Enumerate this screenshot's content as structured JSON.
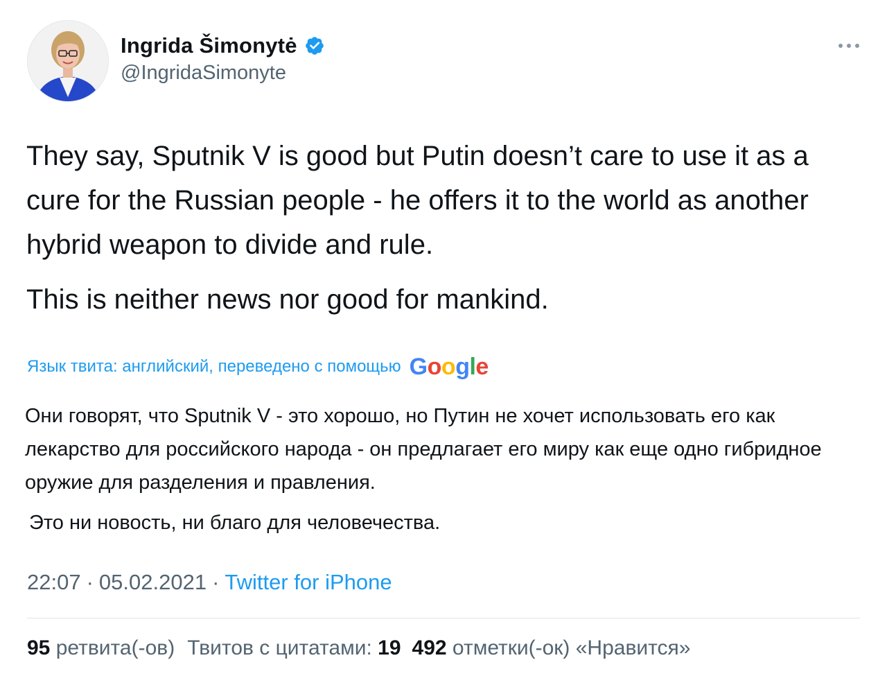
{
  "author": {
    "name": "Ingrida Šimonytė",
    "handle": "@IngridaSimonyte",
    "verified": true,
    "verified_color": "#1d9bf0"
  },
  "tweet": {
    "paragraphs": [
      "They say, Sputnik V is good but Putin doesn’t care to use it as a cure for the Russian people - he offers it to the world as another hybrid weapon to divide and rule.",
      "This is neither news nor good for mankind."
    ]
  },
  "translation": {
    "label": "Язык твита: английский, переведено с помощью",
    "provider_letters": [
      {
        "ch": "G",
        "color": "#4285f4"
      },
      {
        "ch": "o",
        "color": "#ea4335"
      },
      {
        "ch": "o",
        "color": "#fbbc05"
      },
      {
        "ch": "g",
        "color": "#4285f4"
      },
      {
        "ch": "l",
        "color": "#34a853"
      },
      {
        "ch": "e",
        "color": "#ea4335"
      }
    ],
    "paragraphs": [
      "Они говорят, что Sputnik V - это хорошо, но Путин не хочет использовать его как лекарство для российского народа - он предлагает его миру как еще одно гибридное оружие для разделения и правления.",
      "Это ни новость, ни благо для человечества."
    ]
  },
  "meta": {
    "time": "22:07",
    "date": "05.02.2021",
    "separator": "·",
    "source": "Twitter for iPhone"
  },
  "stats": {
    "retweets_count": "95",
    "retweets_label": "ретвита(-ов)",
    "quotes_label": "Твитов с цитатами:",
    "quotes_count": "19",
    "likes_count": "492",
    "likes_label": "отметки(-ок) «Нравится»"
  },
  "icons": {
    "more": "more-horizontal-icon",
    "verified": "verified-badge-icon"
  }
}
